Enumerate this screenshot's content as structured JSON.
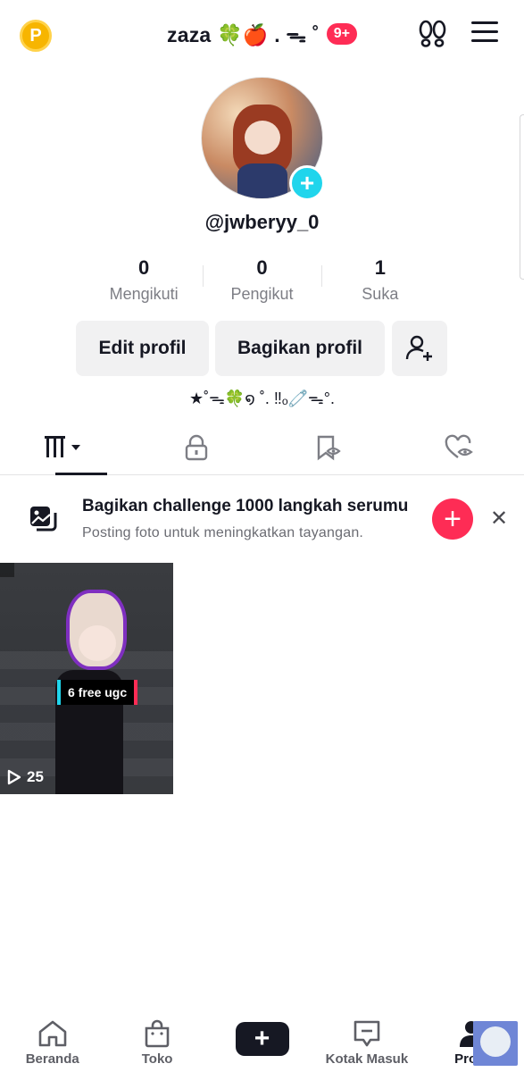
{
  "header": {
    "coin_label": "P",
    "title": "zaza 🍀🍎 . ᯓ ˚",
    "notification_count": "9+"
  },
  "profile": {
    "username": "@jwberyy_0",
    "bio": "★˚ᯓ🍀໑ ˚. ‼︎ₒ🧷ᯓ°."
  },
  "stats": [
    {
      "value": "0",
      "label": "Mengikuti"
    },
    {
      "value": "0",
      "label": "Pengikut"
    },
    {
      "value": "1",
      "label": "Suka"
    }
  ],
  "actions": {
    "edit_label": "Edit profil",
    "share_label": "Bagikan profil"
  },
  "banner": {
    "title": "Bagikan challenge 1000 langkah serumu",
    "subtitle": "Posting foto untuk meningkatkan tayangan."
  },
  "video": {
    "tag": "6 free ugc",
    "views": "25"
  },
  "bottom_nav": {
    "home": "Beranda",
    "shop": "Toko",
    "inbox": "Kotak Masuk",
    "profile": "Profil"
  },
  "colors": {
    "accent_red": "#fe2c55",
    "accent_cyan": "#20d5ec",
    "text": "#161823"
  }
}
